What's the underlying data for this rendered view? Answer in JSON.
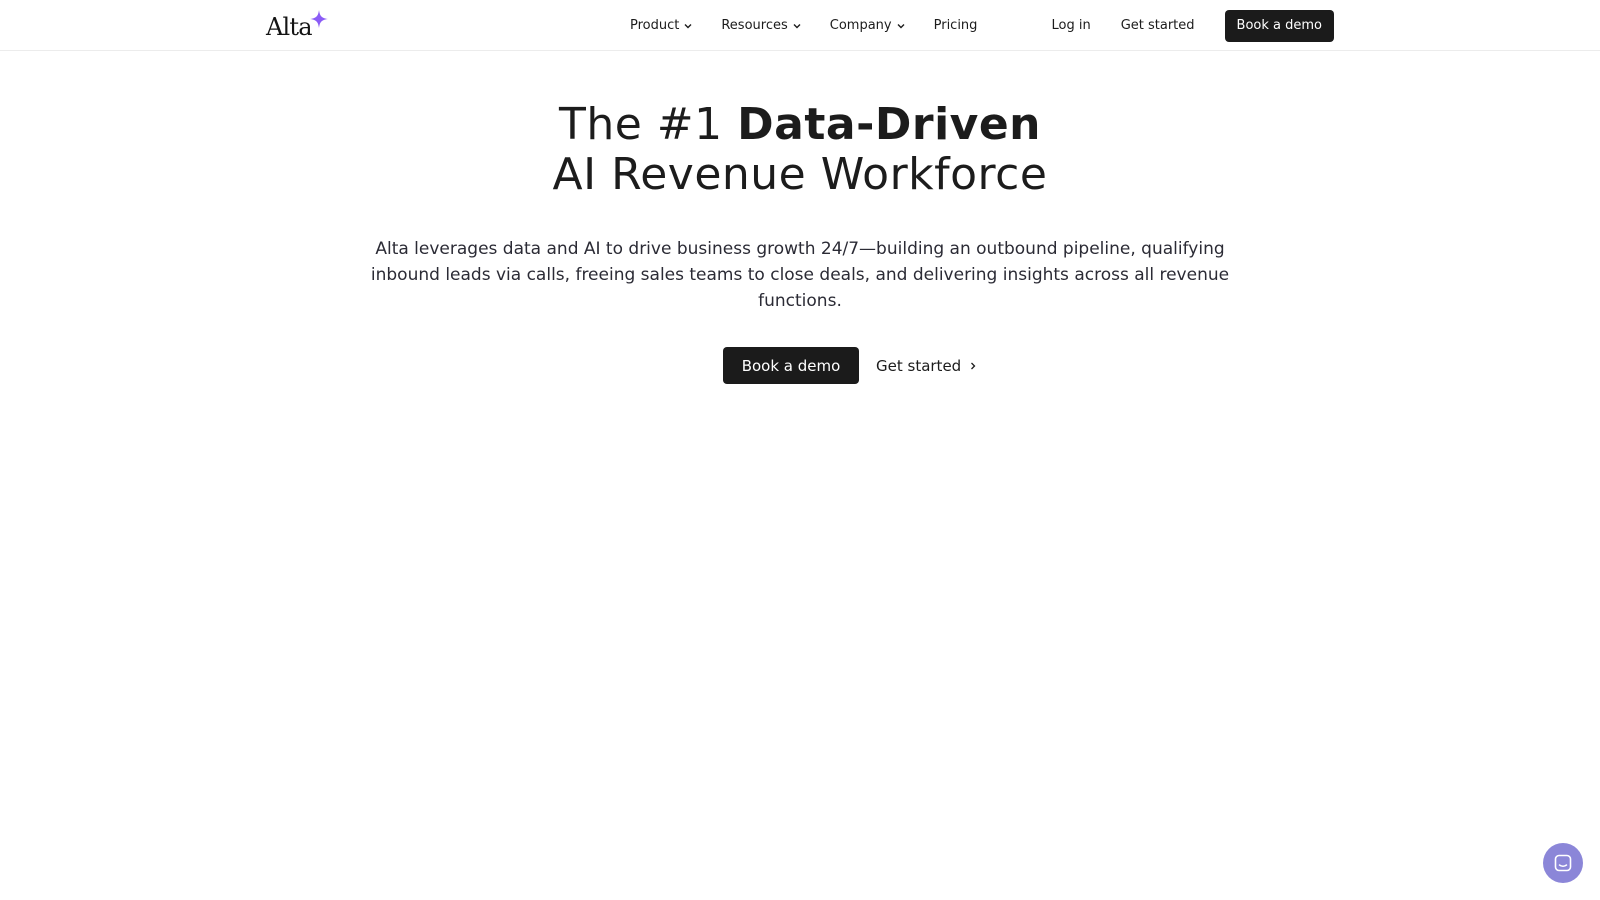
{
  "brand": {
    "logo_text": "Alta",
    "accent_color": "#8b5cf6"
  },
  "nav": {
    "items": [
      {
        "label": "Product",
        "has_dropdown": true
      },
      {
        "label": "Resources",
        "has_dropdown": true
      },
      {
        "label": "Company",
        "has_dropdown": true
      },
      {
        "label": "Pricing",
        "has_dropdown": false
      }
    ],
    "login_label": "Log in",
    "get_started_label": "Get started",
    "book_demo_label": "Book a demo"
  },
  "hero": {
    "title_prefix": "The #1 ",
    "title_bold": "Data-Driven",
    "title_line2": "AI Revenue Workforce",
    "subtitle": "Alta leverages data and AI to drive business growth 24/7—building an outbound pipeline, qualifying inbound leads via calls, freeing sales teams to close deals, and delivering insights across all revenue functions.",
    "cta_primary": "Book a demo",
    "cta_secondary": "Get started"
  },
  "chat_widget": {
    "icon": "chat-icon",
    "color": "#8b86d8"
  }
}
